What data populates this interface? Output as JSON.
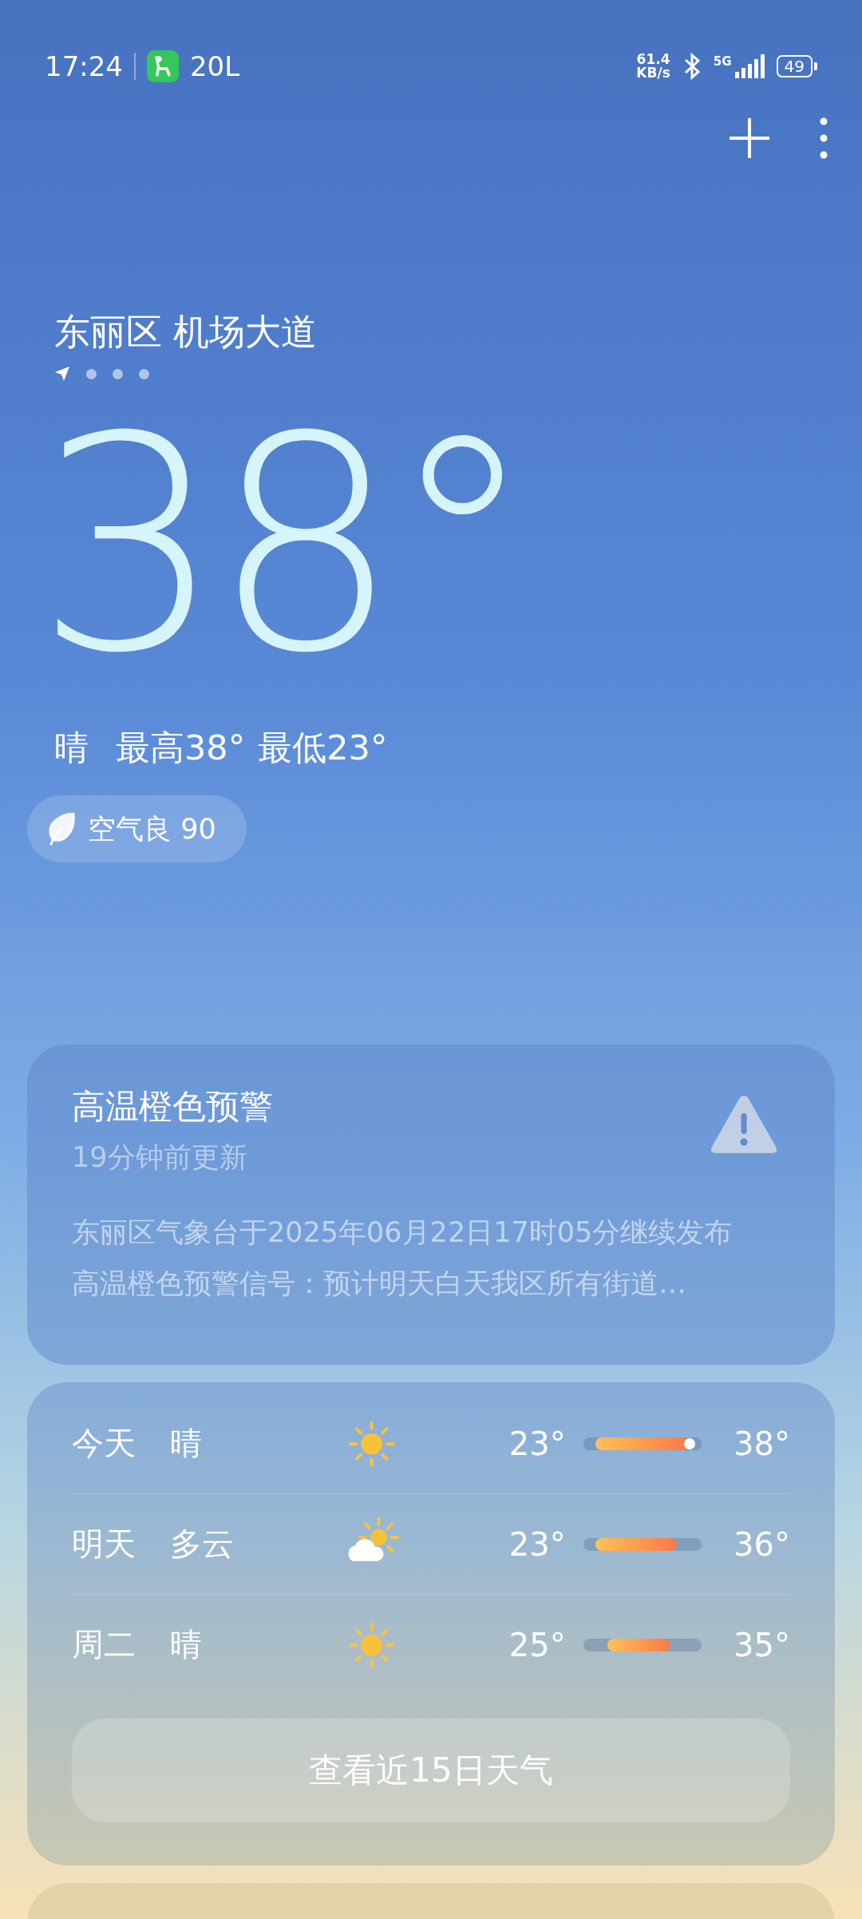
{
  "status_bar": {
    "time": "17:24",
    "app_badge": "20L",
    "net_speed": "61.4",
    "net_unit": "KB/s",
    "network": "5G",
    "battery": "49"
  },
  "location": {
    "name": "东丽区 机场大道",
    "pages": [
      {
        "kind": "location",
        "selected": true
      },
      {
        "kind": "dot",
        "selected": false
      },
      {
        "kind": "dot",
        "selected": false
      },
      {
        "kind": "dot",
        "selected": false
      }
    ]
  },
  "current": {
    "temperature": "38°",
    "condition": "晴",
    "high": "最高38°",
    "low": "最低23°",
    "air_quality": "空气良 90"
  },
  "alert": {
    "title": "高温橙色预警",
    "updated": "19分钟前更新",
    "text": "东丽区气象台于2025年06月22日17时05分继续发布高温橙色预警信号：预计明天白天我区所有街道…"
  },
  "forecast": [
    {
      "day": "今天",
      "condition": "晴",
      "kind": "sunny",
      "low": "23°",
      "high": "38°",
      "current": true
    },
    {
      "day": "明天",
      "condition": "多云",
      "kind": "partly_cloudy",
      "low": "23°",
      "high": "36°",
      "current": false
    },
    {
      "day": "周二",
      "condition": "晴",
      "kind": "sunny",
      "low": "25°",
      "high": "35°",
      "current": false
    }
  ],
  "more_button": "查看近15日天气"
}
